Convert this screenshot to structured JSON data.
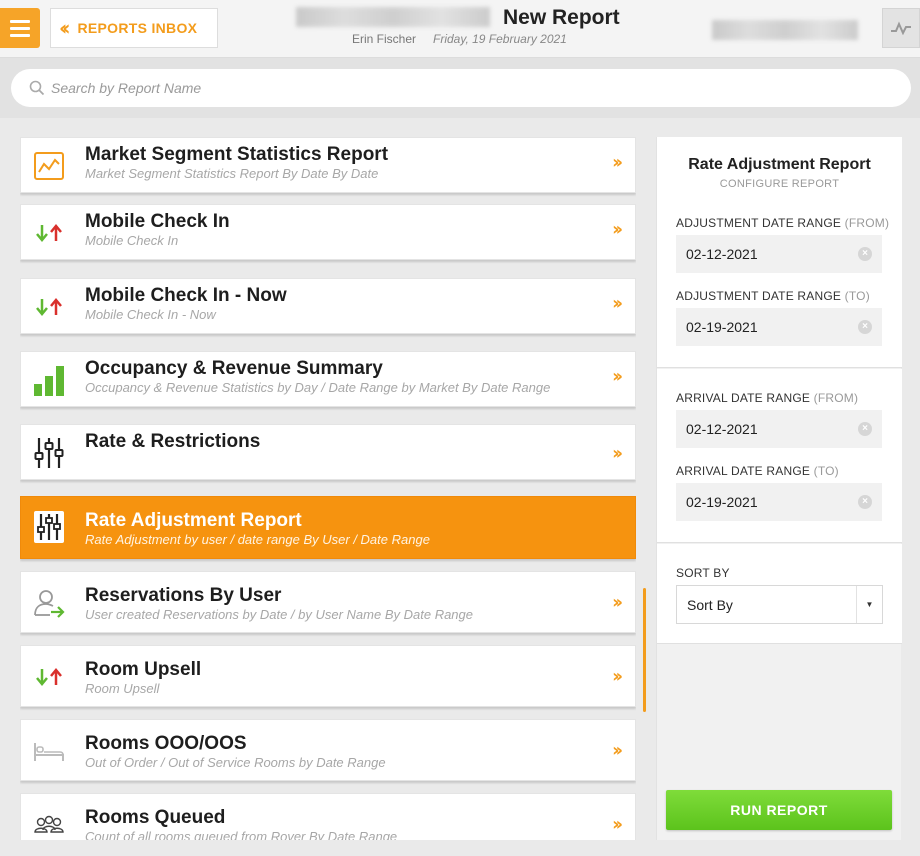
{
  "header": {
    "back_label": "REPORTS INBOX",
    "title": "New Report",
    "user": "Erin Fischer",
    "date": "Friday, 19 February 2021"
  },
  "search": {
    "placeholder": "Search by Report Name"
  },
  "reports": [
    {
      "title": "Market Segment Statistics Report",
      "desc": "Market Segment Statistics Report By Date By Date",
      "icon": "line-chart-icon"
    },
    {
      "title": "Mobile Check In",
      "desc": "Mobile Check In",
      "icon": "arrows-up-down-icon"
    },
    {
      "title": "Mobile Check In - Now",
      "desc": "Mobile Check In - Now",
      "icon": "arrows-up-down-icon"
    },
    {
      "title": "Occupancy & Revenue Summary",
      "desc": "Occupancy & Revenue Statistics by Day / Date Range by Market By Date Range",
      "icon": "bar-chart-icon"
    },
    {
      "title": "Rate & Restrictions",
      "desc": "",
      "icon": "sliders-icon"
    },
    {
      "title": "Rate Adjustment Report",
      "desc": "Rate Adjustment by user / date range By User / Date Range",
      "icon": "sliders-icon",
      "active": true
    },
    {
      "title": "Reservations By User",
      "desc": "User created Reservations by Date / by User Name By Date Range",
      "icon": "user-arrow-icon"
    },
    {
      "title": "Room Upsell",
      "desc": "Room Upsell",
      "icon": "arrows-up-down-icon"
    },
    {
      "title": "Rooms OOO/OOS",
      "desc": "Out of Order / Out of Service Rooms by Date Range",
      "icon": "bed-icon"
    },
    {
      "title": "Rooms Queued",
      "desc": "Count of all rooms queued from Rover By Date Range",
      "icon": "people-icon"
    }
  ],
  "config": {
    "title": "Rate Adjustment Report",
    "subtitle": "CONFIGURE REPORT",
    "adj_from_label": "ADJUSTMENT DATE RANGE",
    "adj_from_qual": "(FROM)",
    "adj_from_value": "02-12-2021",
    "adj_to_label": "ADJUSTMENT DATE RANGE",
    "adj_to_qual": "(TO)",
    "adj_to_value": "02-19-2021",
    "arr_from_label": "ARRIVAL DATE RANGE",
    "arr_from_qual": "(FROM)",
    "arr_from_value": "02-12-2021",
    "arr_to_label": "ARRIVAL DATE RANGE",
    "arr_to_qual": "(TO)",
    "arr_to_value": "02-19-2021",
    "sort_label": "SORT BY",
    "sort_value": "Sort By",
    "run_label": "RUN REPORT"
  },
  "colors": {
    "accent": "#f6930f",
    "run": "#5cc31c"
  }
}
